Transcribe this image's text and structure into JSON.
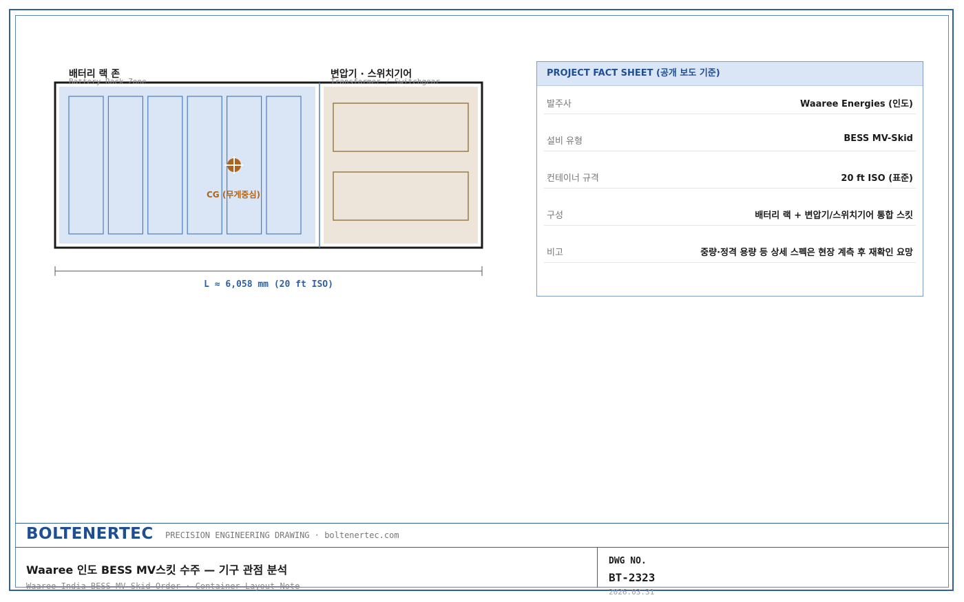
{
  "drawing": {
    "battery_zone": {
      "title": "배터리 랙 존",
      "subtitle": "Battery Rack Zone",
      "rack_count": 6
    },
    "transformer_zone": {
      "title": "변압기 · 스위치기어",
      "subtitle": "Transformer / Switchgear",
      "unit_count": 2
    },
    "cg_label": "CG (무게중심)",
    "dimension_label": "L ≈ 6,058 mm (20 ft ISO)",
    "colors": {
      "battery_fill": "#dae6f6",
      "rack_stroke": "#4a7dc0",
      "switchgear_fill": "#ede5d9",
      "switchgear_stroke": "#9a7b45",
      "cg_color": "#b0641a",
      "outline": "#1a1a1a"
    }
  },
  "fact_sheet": {
    "header": "PROJECT FACT SHEET (공개 보도 기준)",
    "rows": [
      {
        "label": "발주사",
        "value": "Waaree Energies (인도)"
      },
      {
        "label": "설비 유형",
        "value": "BESS MV-Skid"
      },
      {
        "label": "컨테이너 규격",
        "value": "20 ft ISO (표준)"
      },
      {
        "label": "구성",
        "value": "배터리 랙 + 변압기/스위치기어 통합 스킷"
      },
      {
        "label": "비고",
        "value": "중량·정격 용량 등 상세 스펙은 현장 계측 후 재확인 요망"
      }
    ]
  },
  "title_block": {
    "brand": "BOLTENERTEC",
    "tagline": "PRECISION ENGINEERING DRAWING · boltenertec.com",
    "title": "Waaree 인도 BESS MV스킷 수주 — 기구 관점 분석",
    "subtitle": "Waaree India BESS MV Skid Order · Container Layout Note",
    "dwg_label": "DWG NO.",
    "dwg_no": "BT-2323",
    "date": "2026.03.31"
  }
}
